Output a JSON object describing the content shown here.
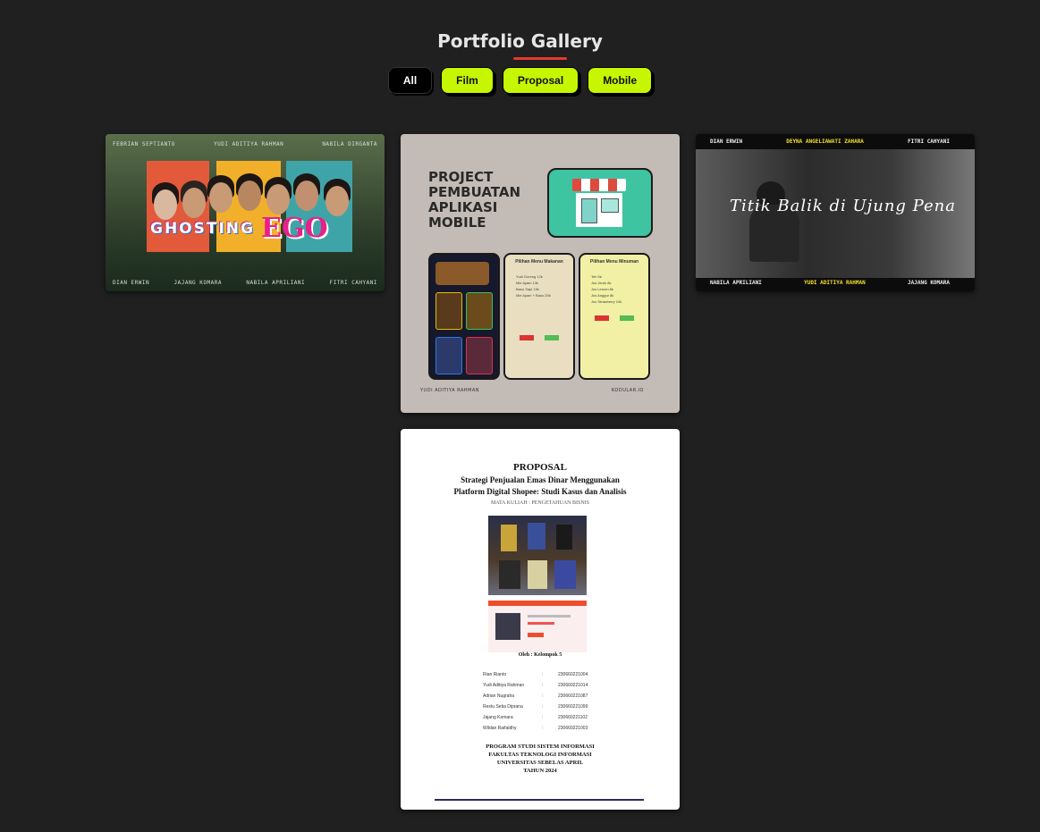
{
  "page": {
    "title": "Portfolio Gallery"
  },
  "filters": [
    {
      "label": "All",
      "active": true
    },
    {
      "label": "Film",
      "active": false
    },
    {
      "label": "Proposal",
      "active": false
    },
    {
      "label": "Mobile",
      "active": false
    }
  ],
  "gallery": {
    "ghosting": {
      "top_names": [
        "FEBRIAN SEPTIANTO",
        "YUDI ADITIYA RAHMAN",
        "NABILA DIRGANTA"
      ],
      "title_a": "GHOSTING",
      "title_b": "EGO",
      "bottom_names": [
        "DIAN ERWIN",
        "JAJANG KOMARA",
        "NABILA APRILIANI",
        "FITRI CAHYANI"
      ]
    },
    "project": {
      "title": "PROJECT PEMBUATAN APLIKASI MOBILE",
      "phone2_heading": "Pilihan Menu Makanan",
      "phone2_items": [
        "Yudi Goreng 12k",
        "Mie Ayam 13k",
        "Baso Sapi 15k",
        "Mie Ayam + Baso 20k"
      ],
      "phone3_heading": "Pilihan Menu Minuman",
      "phone3_items": [
        "Teh 5k",
        "Jus Jeruk 8k",
        "Jus Lemon 8k",
        "Jus Anggur 8k",
        "Jus Strawberry 10k"
      ],
      "author": "YUDI ADITIYA RAHMAN",
      "platform": "KODULAR.IO"
    },
    "titik": {
      "top_names": [
        "DIAN ERWIN",
        "DEYNA ANGELIAWATI ZAHARA",
        "FITRI CAHYANI"
      ],
      "title": "Titik Balik di Ujung Pena",
      "bottom_names": [
        "NABILA APRILIANI",
        "YUDI ADITIYA RAHMAN",
        "JAJANG KOMARA"
      ]
    },
    "proposal": {
      "heading": "PROPOSAL",
      "subtitle_1": "Strategi Penjualan Emas Dinar Menggunakan",
      "subtitle_2": "Platform Digital Shopee: Studi Kasus dan Analisis",
      "course": "MATA KULIAH : PENGETAHUAN BISNIS",
      "by": "Oleh : Kelompok 5",
      "members": [
        {
          "name": "Rian Rianto",
          "nim": "230660221004"
        },
        {
          "name": "Yudi Aditiya Rahman",
          "nim": "230660221014"
        },
        {
          "name": "Adrian Nugraha",
          "nim": "230660221087"
        },
        {
          "name": "Restu Setia Diprana",
          "nim": "230660221099"
        },
        {
          "name": "Jajang Komara",
          "nim": "230660221102"
        },
        {
          "name": "Wildan Raifaldhy",
          "nim": "230660221003"
        }
      ],
      "program": [
        "PROGRAM STUDI SISTEM INFORMASI",
        "FAKULTAS TEKNOLOGI INFORMASI",
        "UNIVERSITAS SEBELAS APRIL",
        "TAHUN 2024"
      ]
    }
  }
}
